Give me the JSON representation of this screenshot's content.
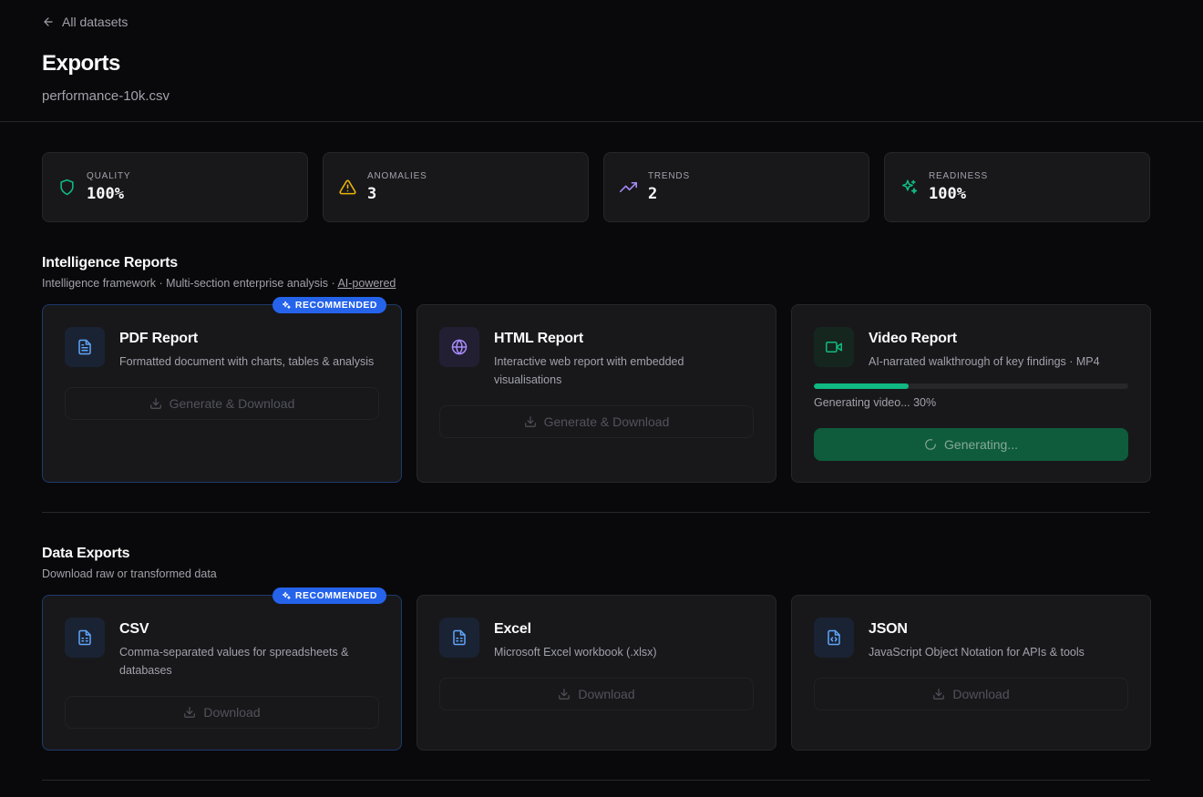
{
  "header": {
    "back_label": "All datasets",
    "title": "Exports",
    "filename": "performance-10k.csv"
  },
  "stats": [
    {
      "label": "QUALITY",
      "value": "100%",
      "icon": "shield-icon",
      "color": "#10b981"
    },
    {
      "label": "ANOMALIES",
      "value": "3",
      "icon": "warning-icon",
      "color": "#eab308"
    },
    {
      "label": "TRENDS",
      "value": "2",
      "icon": "trending-up-icon",
      "color": "#a78bfa"
    },
    {
      "label": "READINESS",
      "value": "100%",
      "icon": "sparkles-icon",
      "color": "#10b981"
    }
  ],
  "intelligence": {
    "title": "Intelligence Reports",
    "desc": "Intelligence framework · Multi-section enterprise analysis · ",
    "desc_link": "AI-powered",
    "cards": [
      {
        "title": "PDF Report",
        "desc": "Formatted document with charts, tables & analysis",
        "button": "Generate & Download",
        "badge": "RECOMMENDED",
        "icon": "document-icon"
      },
      {
        "title": "HTML Report",
        "desc": "Interactive web report with embedded visualisations",
        "button": "Generate & Download",
        "icon": "globe-icon"
      },
      {
        "title": "Video Report",
        "desc": "AI-narrated walkthrough of key findings · MP4",
        "progress": 0.3,
        "progress_text": "Generating video... 30%",
        "button": "Generating...",
        "icon": "video-icon"
      }
    ]
  },
  "data_exports": {
    "title": "Data Exports",
    "desc": "Download raw or transformed data",
    "cards": [
      {
        "title": "CSV",
        "desc": "Comma-separated values for spreadsheets & databases",
        "button": "Download",
        "badge": "RECOMMENDED",
        "icon": "spreadsheet-icon"
      },
      {
        "title": "Excel",
        "desc": "Microsoft Excel workbook (.xlsx)",
        "button": "Download",
        "icon": "spreadsheet-icon"
      },
      {
        "title": "JSON",
        "desc": "JavaScript Object Notation for APIs & tools",
        "button": "Download",
        "icon": "code-file-icon"
      }
    ]
  },
  "colors": {
    "background": "#09090b",
    "card": "#18181b",
    "accent_blue": "#2563eb",
    "accent_green": "#10b981",
    "generating_button": "#0f5c3c"
  }
}
